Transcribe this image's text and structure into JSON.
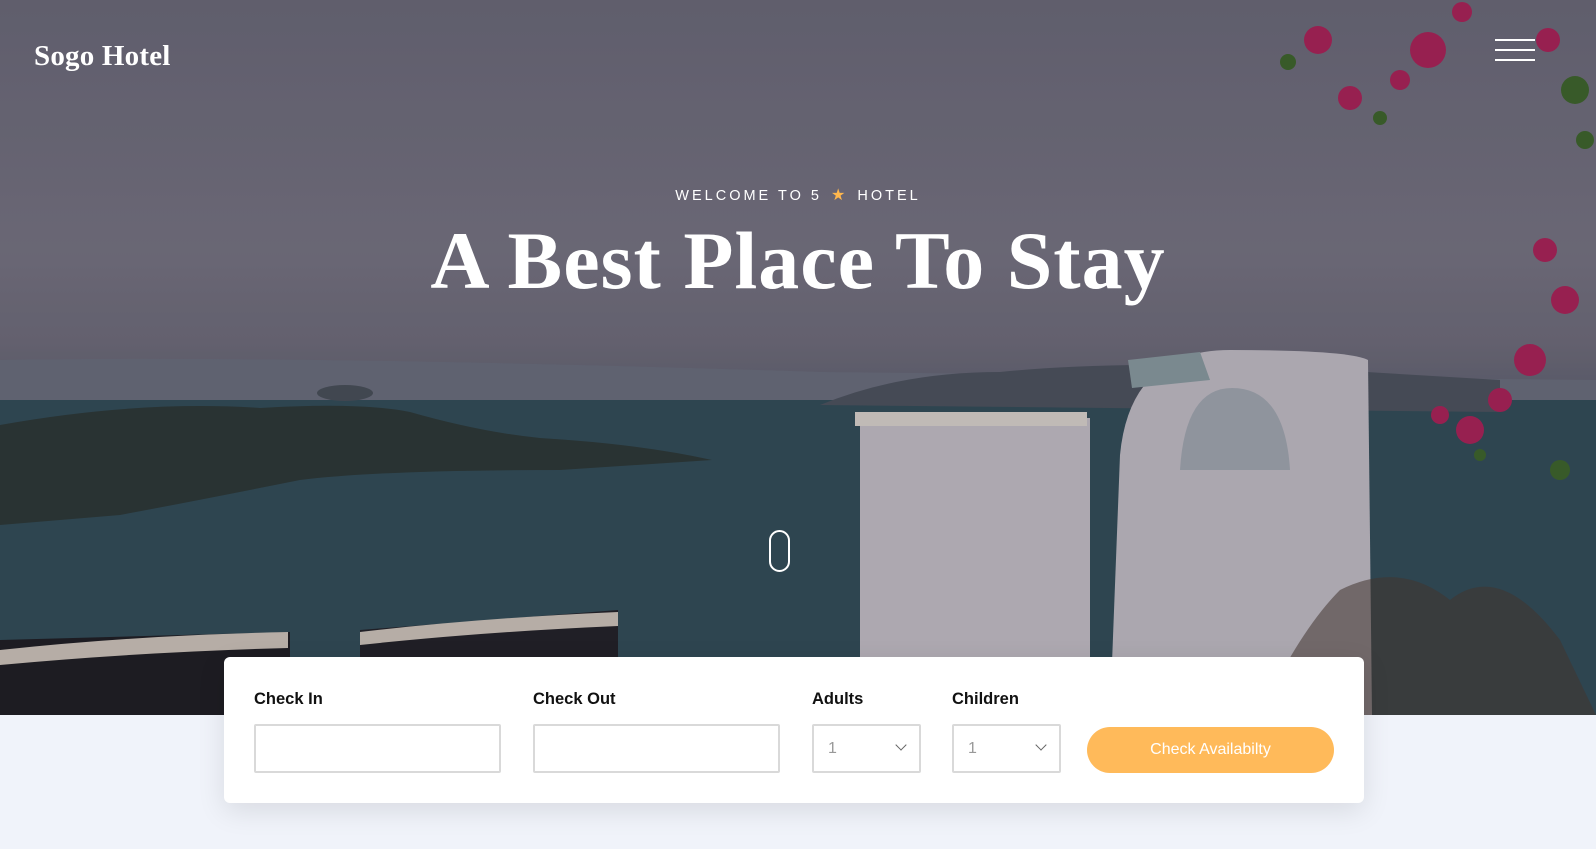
{
  "header": {
    "logo": "Sogo Hotel",
    "menu_icon": "hamburger-menu-icon"
  },
  "hero": {
    "eyebrow_before": "WELCOME TO 5",
    "eyebrow_icon": "star-icon",
    "eyebrow_after": "HOTEL",
    "headline": "A Best Place To Stay",
    "scroll_icon": "mouse-scroll-icon"
  },
  "booking": {
    "check_in": {
      "label": "Check In",
      "value": ""
    },
    "check_out": {
      "label": "Check Out",
      "value": ""
    },
    "adults": {
      "label": "Adults",
      "selected": "1"
    },
    "children": {
      "label": "Children",
      "selected": "1"
    },
    "button": "Check Availabilty"
  },
  "colors": {
    "accent": "#ffba5a",
    "star": "#ffb74d",
    "page_bg": "#f0f3fa"
  }
}
